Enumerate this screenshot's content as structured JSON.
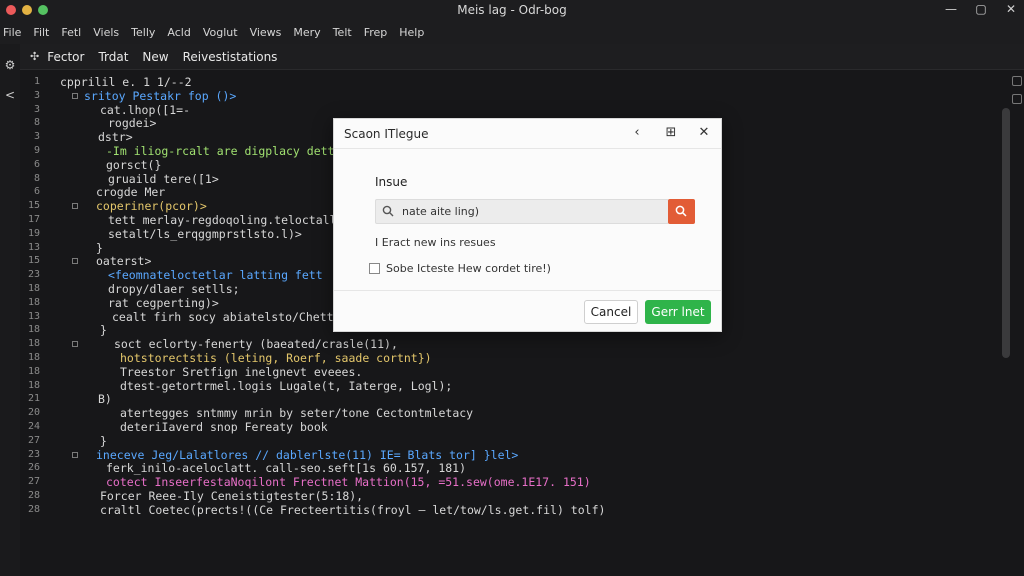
{
  "window": {
    "title": "Meis lag - Odr-bog"
  },
  "menu": [
    "File",
    "Filt",
    "Fetl",
    "Viels",
    "Telly",
    "Acld",
    "Voglut",
    "Views",
    "Mery",
    "Telt",
    "Frep",
    "Help"
  ],
  "toolbar": [
    "Fector",
    "Trdat",
    "New",
    "Reivestistations"
  ],
  "colors": {
    "keyword": "#5aa8ff",
    "string": "#a0e070",
    "string2": "#e4c76b",
    "accent": "#e86fc8",
    "number": "#f0a050",
    "primary_button": "#2fb44a",
    "search_button": "#e25c36"
  },
  "editor": {
    "line_numbers": [
      "1",
      "3",
      "3",
      "8",
      "3",
      "9",
      "6",
      "8",
      "6",
      "15",
      "17",
      "19",
      "13",
      "15",
      "23",
      "18",
      "18",
      "13",
      "18",
      "18",
      "18",
      "18",
      "18",
      "21",
      "20",
      "24",
      "27",
      "23",
      "26",
      "27",
      "28",
      "28",
      "28"
    ],
    "lines": [
      "cpprilil e. 1 1/--2",
      "sritoy Pestakr fop ()>",
      "cat.lhop([1=-",
      "rogdei>",
      "dstr>",
      "-Im iliog-rcalt are digplacy dettle",
      "gorsct(}",
      "gruaild tere([1>",
      "crogde Mer",
      "coperiner(pcor)>",
      "tett merlay-regdoqoling.teloctall",
      "setalt/ls_erqggmprstlsto.l)>",
      "}",
      "oaterst>",
      "<feomnateloctetlar latting fett",
      "dropy/dlaer setlls;",
      "rat cegperting)>",
      "cealt firh socy abiatelsto/Chettsy",
      "}",
      "soct eclorty-fenerty (baeated/crasle(11),",
      "hotstorectstis (leting, Roerf, saade cortnt})",
      "Treestor Sretfign inelgnevt eveees.",
      "dtest-getortrmel.logis Lugale(t, Iaterge, Logl);",
      "B)",
      "atertegges sntmmy mrin by seter/tone Cectontmletacy",
      "deteriIaverd snop Fereaty book",
      "}",
      "ineceve Jeg/Lalatlores // dablerlste(11) IE= Blats tor] }lel>",
      "ferk_inilo-aceloclatt. call-seo.seft[1s 60.157, 181)",
      "cotect InseerfestaNoqilont Frectnet Mattion(15, =51.sew(ome.1E17. 151)",
      "Forcer Reee-Ily Ceneistigtester(5:18),",
      "craltl Coetec(prects!((Ce Frecteertitis(froyl — let/tow/ls.get.fil) tolf)"
    ]
  },
  "dialog": {
    "title": "Scaon ITlegue",
    "label": "Insue",
    "search_value": "nate aite ling)",
    "option1": "I Eract new ins resues",
    "option2": "Sobe Icteste Hew cordet tire!)",
    "cancel": "Cancel",
    "primary": "Gerr lnet"
  }
}
